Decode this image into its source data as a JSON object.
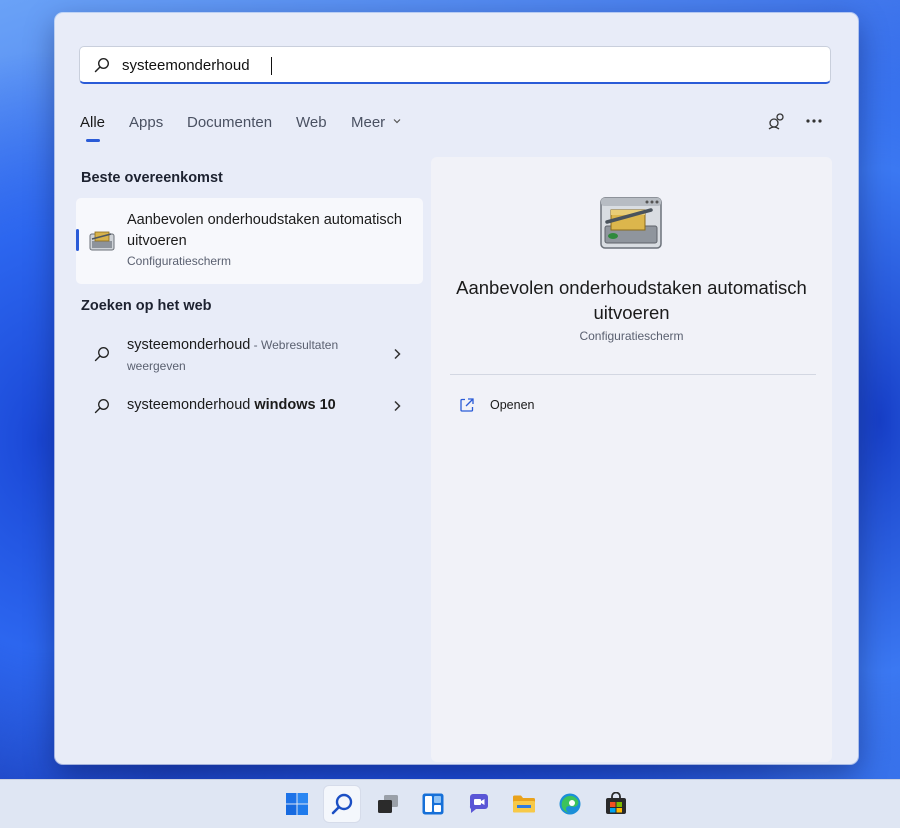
{
  "search": {
    "query": "systeemonderhoud"
  },
  "tabs": [
    "Alle",
    "Apps",
    "Documenten",
    "Web",
    "Meer"
  ],
  "sections": {
    "best_match": "Beste overeenkomst",
    "web_search": "Zoeken op het web"
  },
  "best_match": {
    "name": "Aanbevolen onderhoudstaken automatisch uitvoeren",
    "subtitle": "Configuratiescherm"
  },
  "web_results": [
    {
      "text": "systeemonderhoud",
      "suffix": " - Webresultaten weergeven"
    },
    {
      "text": "systeemonderhoud",
      "bold_suffix": " windows 10"
    }
  ],
  "preview": {
    "title": "Aanbevolen onderhoudstaken automatisch uitvoeren",
    "subtitle": "Configuratiescherm",
    "action": "Openen"
  },
  "colors": {
    "accent": "#2a5bd7",
    "panel": "#e8ecf8"
  },
  "icons": [
    "search-icon",
    "chevron-down-icon",
    "share-icon",
    "more-icon",
    "chevron-right-icon",
    "external-link-icon",
    "maintenance-icon"
  ],
  "taskbar": [
    "windows-start-icon",
    "search-icon",
    "task-view-icon",
    "widgets-icon",
    "chat-icon",
    "file-explorer-icon",
    "edge-icon",
    "store-icon"
  ]
}
